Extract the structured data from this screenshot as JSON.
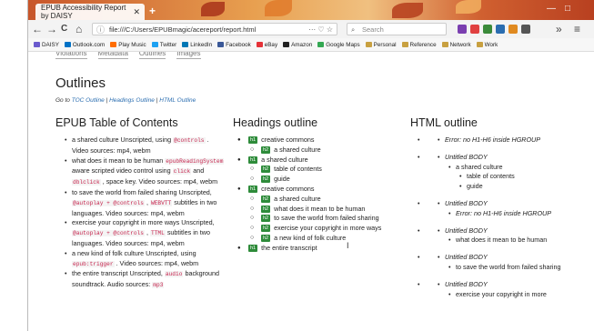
{
  "browser": {
    "tab_title": "EPUB Accessibility Report by DAISY",
    "tab_close": "✕",
    "new_tab": "+",
    "url": "file:///C:/Users/EPUBmagic/acereport/report.html",
    "url_tail": "··· ♡ ☆",
    "search_placeholder": "Search",
    "back": "←",
    "forward": "→",
    "reload": "C",
    "home": "⌂",
    "minimize": "—",
    "restore": "□",
    "more": "»",
    "menu": "≡"
  },
  "bookmarks": [
    {
      "label": "DAISY",
      "color": "#6a5acd"
    },
    {
      "label": "Outlook.com",
      "color": "#0072c6"
    },
    {
      "label": "Play Music",
      "color": "#ff6d00"
    },
    {
      "label": "Twitter",
      "color": "#1da1f2"
    },
    {
      "label": "LinkedIn",
      "color": "#0077b5"
    },
    {
      "label": "Facebook",
      "color": "#3b5998"
    },
    {
      "label": "eBay",
      "color": "#e53238"
    },
    {
      "label": "Amazon",
      "color": "#222222"
    },
    {
      "label": "Google Maps",
      "color": "#34a853"
    },
    {
      "label": "Personal",
      "color": "#c8a040"
    },
    {
      "label": "Reference",
      "color": "#c8a040"
    },
    {
      "label": "Network",
      "color": "#c8a040"
    },
    {
      "label": "Work",
      "color": "#c8a040"
    }
  ],
  "report_tabs": [
    "Violations",
    "Metadata",
    "Outlines",
    "Images"
  ],
  "page": {
    "title": "Outlines",
    "goto_prefix": "Go to",
    "goto_toc": "TOC Outline",
    "goto_headings": "Headings Outline",
    "goto_html": "HTML Outline",
    "sep": "|"
  },
  "epub_toc": {
    "title": "EPUB Table of Contents",
    "items": [
      {
        "parts": [
          {
            "t": "a shared culture Unscripted, using "
          },
          {
            "c": "@controls"
          },
          {
            "t": " . Video sources: mp4, webm"
          }
        ]
      },
      {
        "parts": [
          {
            "t": "what does it mean to be human "
          },
          {
            "c": "epubReadingSystem"
          },
          {
            "t": " aware scripted video control using "
          },
          {
            "c": "click"
          },
          {
            "t": " and "
          },
          {
            "c": "dblclick"
          },
          {
            "t": " , space key. Video sources: mp4, webm"
          }
        ]
      },
      {
        "parts": [
          {
            "t": "to save the world from failed sharing Unscripted, "
          },
          {
            "c": "@autoplay + @controls"
          },
          {
            "t": " , "
          },
          {
            "c": "WEBVTT"
          },
          {
            "t": " subtitles in two languages. Video sources: mp4, webm"
          }
        ]
      },
      {
        "parts": [
          {
            "t": "exercise your copyright in more ways Unscripted, "
          },
          {
            "c": "@autoplay + @controls"
          },
          {
            "t": " , "
          },
          {
            "c": "TTML"
          },
          {
            "t": " subtitles in two languages. Video sources: mp4, webm"
          }
        ]
      },
      {
        "parts": [
          {
            "t": "a new kind of folk culture Unscripted, using "
          },
          {
            "c": "epub:trigger"
          },
          {
            "t": " . Video sources: mp4, webm"
          }
        ]
      },
      {
        "parts": [
          {
            "t": "the entire transcript Unscripted, "
          },
          {
            "c": "audio"
          },
          {
            "t": " background soundtrack. Audio sources: "
          },
          {
            "c": "mp3"
          }
        ]
      }
    ]
  },
  "headings": {
    "title": "Headings outline",
    "items": [
      {
        "level": 1,
        "badge": "h1",
        "text": "creative commons"
      },
      {
        "level": 2,
        "badge": "h2",
        "text": "a shared culture"
      },
      {
        "level": 1,
        "badge": "h1",
        "text": "a shared culture"
      },
      {
        "level": 2,
        "badge": "h2",
        "text": "table of contents"
      },
      {
        "level": 2,
        "badge": "h2",
        "text": "guide"
      },
      {
        "level": 1,
        "badge": "h1",
        "text": "creative commons"
      },
      {
        "level": 2,
        "badge": "h2",
        "text": "a shared culture"
      },
      {
        "level": 2,
        "badge": "h2",
        "text": "what does it mean to be human"
      },
      {
        "level": 2,
        "badge": "h2",
        "text": "to save the world from failed sharing"
      },
      {
        "level": 2,
        "badge": "h2",
        "text": "exercise your copyright in more ways"
      },
      {
        "level": 2,
        "badge": "h2",
        "text": "a new kind of folk culture"
      },
      {
        "level": 1,
        "badge": "h1",
        "text": "the entire transcript"
      }
    ]
  },
  "html_outline": {
    "title": "HTML outline",
    "groups": [
      [
        {
          "level": 1,
          "text": "Error: no H1-H6 inside HGROUP",
          "italic": true
        }
      ],
      [
        {
          "level": 1,
          "text": "Untitled BODY",
          "italic": true
        },
        {
          "level": 2,
          "text": "a shared culture",
          "italic": false
        },
        {
          "level": 3,
          "text": "table of contents",
          "italic": false
        },
        {
          "level": 3,
          "text": "guide",
          "italic": false
        }
      ],
      [
        {
          "level": 1,
          "text": "Untitled BODY",
          "italic": true
        },
        {
          "level": 2,
          "text": "Error: no H1-H6 inside HGROUP",
          "italic": true
        }
      ],
      [
        {
          "level": 1,
          "text": "Untitled BODY",
          "italic": true
        },
        {
          "level": 2,
          "text": "what does it mean to be human",
          "italic": false
        }
      ],
      [
        {
          "level": 1,
          "text": "Untitled BODY",
          "italic": true
        },
        {
          "level": 2,
          "text": "to save the world from failed sharing",
          "italic": false
        }
      ],
      [
        {
          "level": 1,
          "text": "Untitled BODY",
          "italic": true
        },
        {
          "level": 2,
          "text": "exercise your copyright in more",
          "italic": false
        }
      ]
    ]
  }
}
